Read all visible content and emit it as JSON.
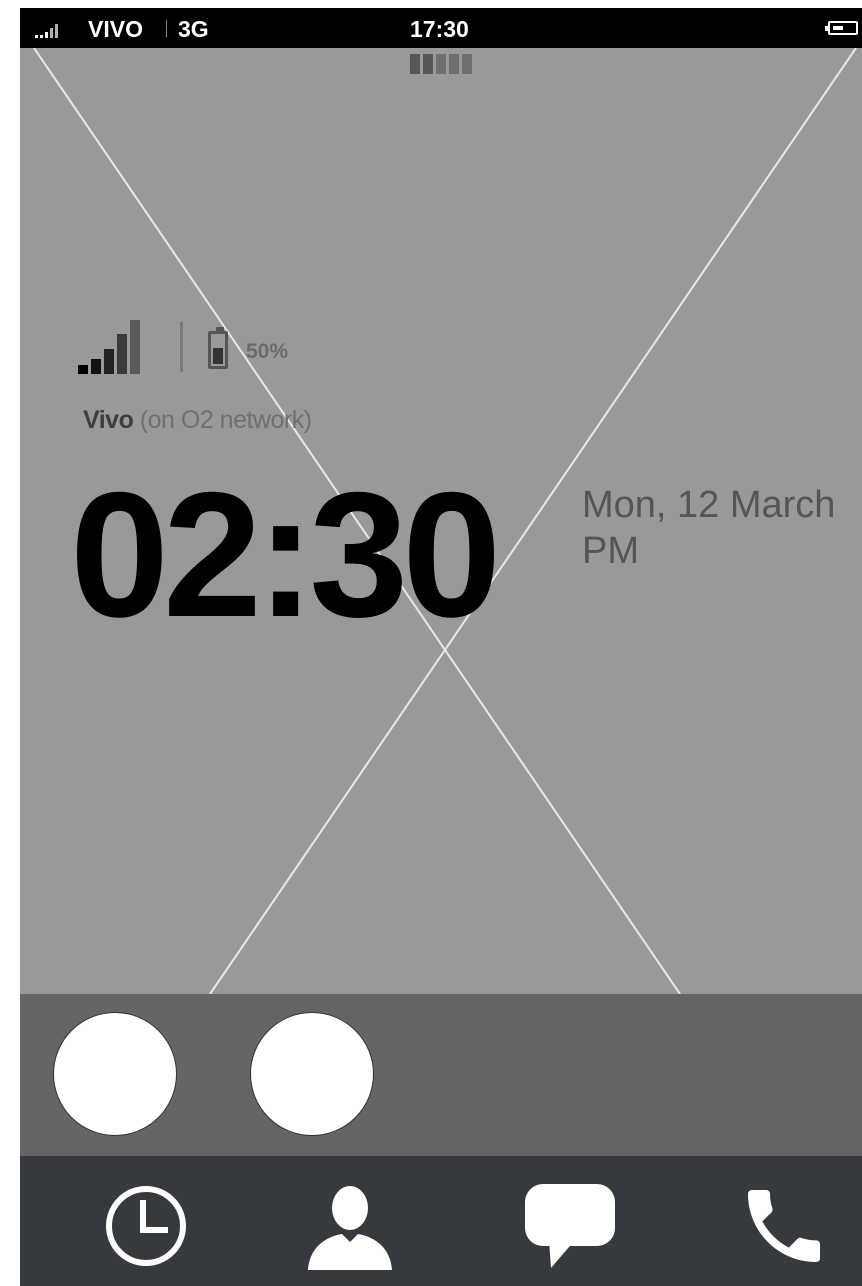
{
  "status_bar": {
    "carrier": "VIVO",
    "network_type": "3G",
    "time": "17:30",
    "icons": [
      "signal-icon",
      "battery-icon"
    ]
  },
  "lock_screen": {
    "battery_percent": "50%",
    "battery_level": 0.5,
    "carrier_name": "Vivo",
    "carrier_network": "(on O2 network)",
    "clock": "02:30",
    "date_line1": "Mon, 12 March",
    "date_line2": "PM",
    "icons": [
      "signal-icon",
      "battery-icon"
    ]
  },
  "notifications": [
    {
      "name": "notification-bubble-1"
    },
    {
      "name": "notification-bubble-2"
    }
  ],
  "dock": {
    "items": [
      {
        "name": "clock-icon"
      },
      {
        "name": "contacts-icon"
      },
      {
        "name": "messages-icon"
      },
      {
        "name": "phone-icon"
      }
    ]
  },
  "colors": {
    "wallpaper": "#999999",
    "tray": "#656565",
    "dock": "#36393d",
    "status_bar": "#000000"
  }
}
